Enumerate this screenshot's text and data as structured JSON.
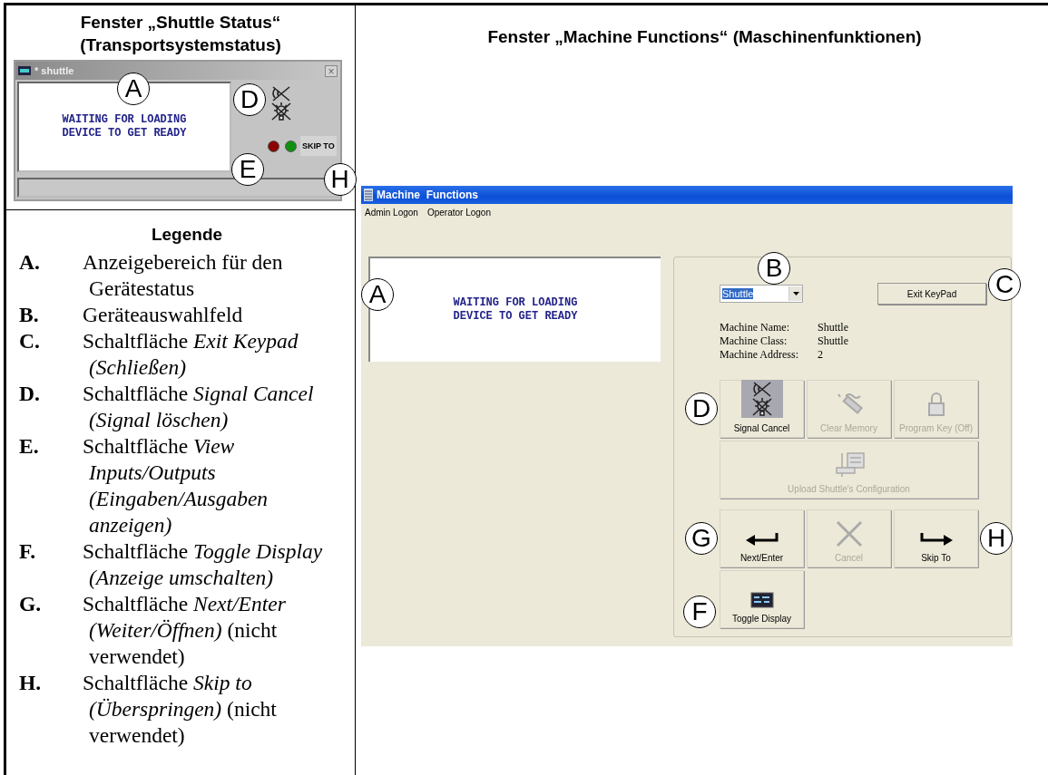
{
  "left_column": {
    "heading": "Fenster „Shuttle Status“ (Transportsystemstatus)",
    "shuttle_window": {
      "title": "* shuttle",
      "close_button": "×",
      "display_lines": [
        "WAITING FOR LOADING",
        "DEVICE TO GET READY"
      ],
      "display_callout": "A",
      "signal_callout": "D",
      "indicators": [
        {
          "color": "#8b0000"
        },
        {
          "color": "#109010"
        }
      ],
      "indicators_callout": "E",
      "skip_button": "SKIP TO",
      "skip_callout": "H"
    },
    "legend": {
      "heading": "Legende",
      "items": [
        {
          "letter": "A.",
          "text": "Anzeigebereich für den Gerätestatus"
        },
        {
          "letter": "B.",
          "text": "Geräteauswahlfeld"
        },
        {
          "letter": "C.",
          "text": "Schaltfläche *Exit Keypad (Schließen)*"
        },
        {
          "letter": "D.",
          "text": "Schaltfläche *Signal Cancel (Signal löschen)*"
        },
        {
          "letter": "E.",
          "text": "Schaltfläche *View Inputs/Outputs (Eingaben/Ausgaben anzeigen)*"
        },
        {
          "letter": "F.",
          "text": "Schaltfläche *Toggle Display (Anzeige umschalten)*"
        },
        {
          "letter": "G.",
          "text": "Schaltfläche *Next/Enter (Weiter/Öffnen)* (nicht verwendet)"
        },
        {
          "letter": "H.",
          "text": "Schaltfläche *Skip to (Überspringen)* (nicht verwendet)"
        }
      ]
    }
  },
  "right_column": {
    "heading": "Fenster „Machine Functions“ (Maschinenfunktionen)",
    "machine_window": {
      "title": "Machine  Functions",
      "menu": [
        "Admin Logon",
        "Operator Logon"
      ],
      "display_lines": [
        "WAITING FOR LOADING",
        "DEVICE TO GET READY"
      ],
      "display_callout": "A",
      "device_select": {
        "value": "Shuttle",
        "callout": "B"
      },
      "exit_button": {
        "label": "Exit KeyPad",
        "callout": "C"
      },
      "info": [
        {
          "label": "Machine Name:",
          "value": "Shuttle"
        },
        {
          "label": "Machine Class:",
          "value": "Shuttle"
        },
        {
          "label": "Machine Address:",
          "value": "2"
        }
      ],
      "button_rows": [
        [
          {
            "label": "Signal Cancel",
            "kind": "signal",
            "disabled": false,
            "callout": "D"
          },
          {
            "label": "Clear Memory",
            "kind": "wand",
            "disabled": true
          },
          {
            "label": "Program Key (Off)",
            "kind": "lock",
            "disabled": true
          }
        ],
        [
          {
            "label": "Upload Shuttle's Configuration",
            "kind": "upload",
            "disabled": true
          }
        ],
        [
          {
            "label": "Next/Enter",
            "kind": "enter",
            "disabled": false,
            "callout": "G"
          },
          {
            "label": "Cancel",
            "kind": "cross",
            "disabled": true
          },
          {
            "label": "Skip To",
            "kind": "skip",
            "disabled": false,
            "callout": "H"
          }
        ],
        [
          {
            "label": "Toggle Display",
            "kind": "monitor",
            "disabled": false,
            "callout": "F"
          }
        ]
      ]
    }
  }
}
